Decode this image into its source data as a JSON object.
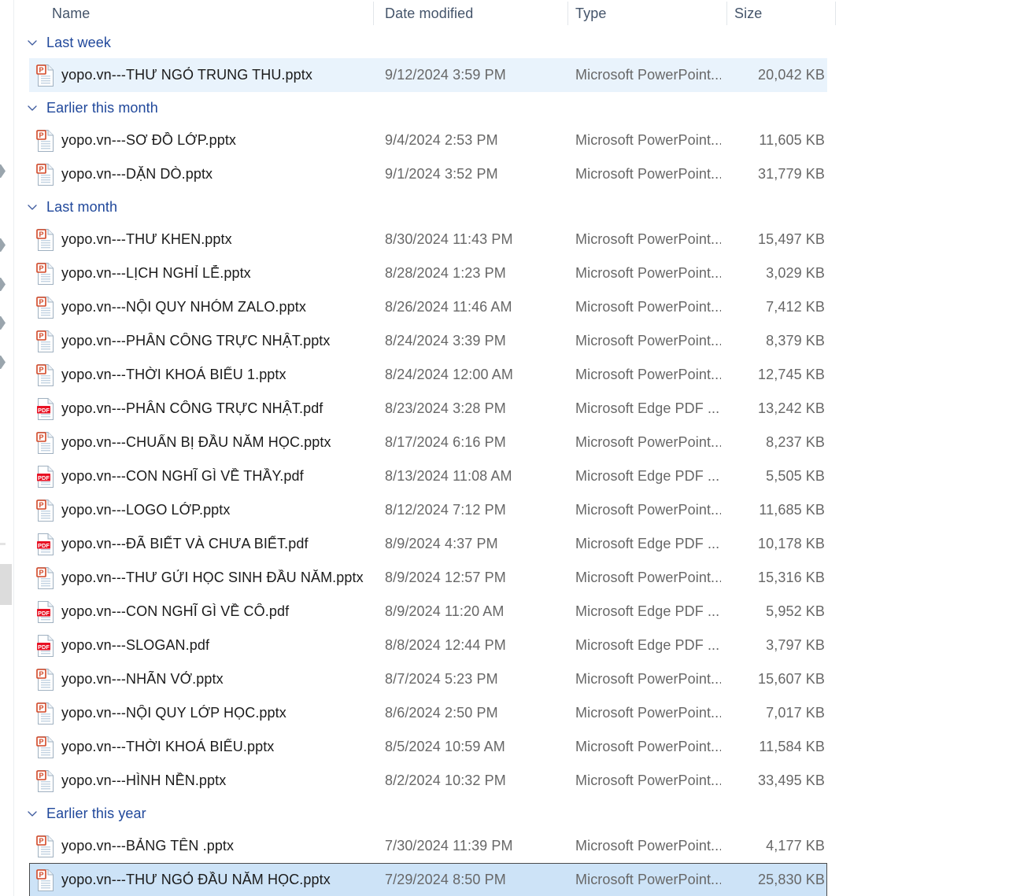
{
  "window": {
    "view": "Details",
    "accent_selected_light": "#e9f3fc",
    "accent_selected_strong": "#cde3f7",
    "group_label_color": "#20489b",
    "header_text_color": "#44546a"
  },
  "columns": [
    {
      "id": "name",
      "label": "Name"
    },
    {
      "id": "date",
      "label": "Date modified"
    },
    {
      "id": "type",
      "label": "Type"
    },
    {
      "id": "size",
      "label": "Size"
    }
  ],
  "icons": {
    "chevron_down": "chevron-down-icon",
    "powerpoint": "powerpoint-file-icon",
    "pdf": "pdf-file-icon"
  },
  "groups": [
    {
      "label": "Last week",
      "expanded": true,
      "items": [
        {
          "icon": "powerpoint",
          "name": "yopo.vn---THƯ NGỎ TRUNG THU.pptx",
          "date": "9/12/2024 3:59 PM",
          "type": "Microsoft PowerPoint...",
          "size": "20,042 KB",
          "selected": "light"
        }
      ]
    },
    {
      "label": "Earlier this month",
      "expanded": true,
      "items": [
        {
          "icon": "powerpoint",
          "name": "yopo.vn---SƠ ĐỒ LỚP.pptx",
          "date": "9/4/2024 2:53 PM",
          "type": "Microsoft PowerPoint...",
          "size": "11,605 KB",
          "selected": "none"
        },
        {
          "icon": "powerpoint",
          "name": "yopo.vn---DẶN DÒ.pptx",
          "date": "9/1/2024 3:52 PM",
          "type": "Microsoft PowerPoint...",
          "size": "31,779 KB",
          "selected": "none"
        }
      ]
    },
    {
      "label": "Last month",
      "expanded": true,
      "items": [
        {
          "icon": "powerpoint",
          "name": "yopo.vn---THƯ KHEN.pptx",
          "date": "8/30/2024 11:43 PM",
          "type": "Microsoft PowerPoint...",
          "size": "15,497 KB",
          "selected": "none"
        },
        {
          "icon": "powerpoint",
          "name": "yopo.vn---LỊCH NGHỈ LỄ.pptx",
          "date": "8/28/2024 1:23 PM",
          "type": "Microsoft PowerPoint...",
          "size": "3,029 KB",
          "selected": "none"
        },
        {
          "icon": "powerpoint",
          "name": "yopo.vn---NỘI QUY NHÓM ZALO.pptx",
          "date": "8/26/2024 11:46 AM",
          "type": "Microsoft PowerPoint...",
          "size": "7,412 KB",
          "selected": "none"
        },
        {
          "icon": "powerpoint",
          "name": "yopo.vn---PHÂN CÔNG TRỰC NHẬT.pptx",
          "date": "8/24/2024 3:39 PM",
          "type": "Microsoft PowerPoint...",
          "size": "8,379 KB",
          "selected": "none"
        },
        {
          "icon": "powerpoint",
          "name": "yopo.vn---THỜI KHOÁ BIỂU 1.pptx",
          "date": "8/24/2024 12:00 AM",
          "type": "Microsoft PowerPoint...",
          "size": "12,745 KB",
          "selected": "none"
        },
        {
          "icon": "pdf",
          "name": "yopo.vn---PHÂN CÔNG TRỰC NHẬT.pdf",
          "date": "8/23/2024 3:28 PM",
          "type": "Microsoft Edge PDF ...",
          "size": "13,242 KB",
          "selected": "none"
        },
        {
          "icon": "powerpoint",
          "name": "yopo.vn---CHUẨN BỊ ĐẦU NĂM HỌC.pptx",
          "date": "8/17/2024 6:16 PM",
          "type": "Microsoft PowerPoint...",
          "size": "8,237 KB",
          "selected": "none"
        },
        {
          "icon": "pdf",
          "name": "yopo.vn---CON NGHĨ GÌ VỀ THẦY.pdf",
          "date": "8/13/2024 11:08 AM",
          "type": "Microsoft Edge PDF ...",
          "size": "5,505 KB",
          "selected": "none"
        },
        {
          "icon": "powerpoint",
          "name": "yopo.vn---LOGO LỚP.pptx",
          "date": "8/12/2024 7:12 PM",
          "type": "Microsoft PowerPoint...",
          "size": "11,685 KB",
          "selected": "none"
        },
        {
          "icon": "pdf",
          "name": "yopo.vn---ĐÃ BIẾT VÀ CHƯA BIẾT.pdf",
          "date": "8/9/2024 4:37 PM",
          "type": "Microsoft Edge PDF ...",
          "size": "10,178 KB",
          "selected": "none"
        },
        {
          "icon": "powerpoint",
          "name": "yopo.vn---THƯ GỬI HỌC SINH ĐẦU NĂM.pptx",
          "date": "8/9/2024 12:57 PM",
          "type": "Microsoft PowerPoint...",
          "size": "15,316 KB",
          "selected": "none"
        },
        {
          "icon": "pdf",
          "name": "yopo.vn---CON NGHĨ GÌ VỀ CÔ.pdf",
          "date": "8/9/2024 11:20 AM",
          "type": "Microsoft Edge PDF ...",
          "size": "5,952 KB",
          "selected": "none"
        },
        {
          "icon": "pdf",
          "name": "yopo.vn---SLOGAN.pdf",
          "date": "8/8/2024 12:44 PM",
          "type": "Microsoft Edge PDF ...",
          "size": "3,797 KB",
          "selected": "none"
        },
        {
          "icon": "powerpoint",
          "name": "yopo.vn---NHÃN VỞ.pptx",
          "date": "8/7/2024 5:23 PM",
          "type": "Microsoft PowerPoint...",
          "size": "15,607 KB",
          "selected": "none"
        },
        {
          "icon": "powerpoint",
          "name": "yopo.vn---NỘI QUY LỚP HỌC.pptx",
          "date": "8/6/2024 2:50 PM",
          "type": "Microsoft PowerPoint...",
          "size": "7,017 KB",
          "selected": "none"
        },
        {
          "icon": "powerpoint",
          "name": "yopo.vn---THỜI KHOÁ BIỂU.pptx",
          "date": "8/5/2024 10:59 AM",
          "type": "Microsoft PowerPoint...",
          "size": "11,584 KB",
          "selected": "none"
        },
        {
          "icon": "powerpoint",
          "name": "yopo.vn---HÌNH NỀN.pptx",
          "date": "8/2/2024 10:32 PM",
          "type": "Microsoft PowerPoint...",
          "size": "33,495 KB",
          "selected": "none"
        }
      ]
    },
    {
      "label": "Earlier this year",
      "expanded": true,
      "items": [
        {
          "icon": "powerpoint",
          "name": "yopo.vn---BẢNG TÊN .pptx",
          "date": "7/30/2024 11:39 PM",
          "type": "Microsoft PowerPoint...",
          "size": "4,177 KB",
          "selected": "none"
        },
        {
          "icon": "powerpoint",
          "name": "yopo.vn---THƯ NGỎ ĐẦU NĂM HỌC.pptx",
          "date": "7/29/2024 8:50 PM",
          "type": "Microsoft PowerPoint...",
          "size": "25,830 KB",
          "selected": "strong"
        }
      ]
    }
  ]
}
